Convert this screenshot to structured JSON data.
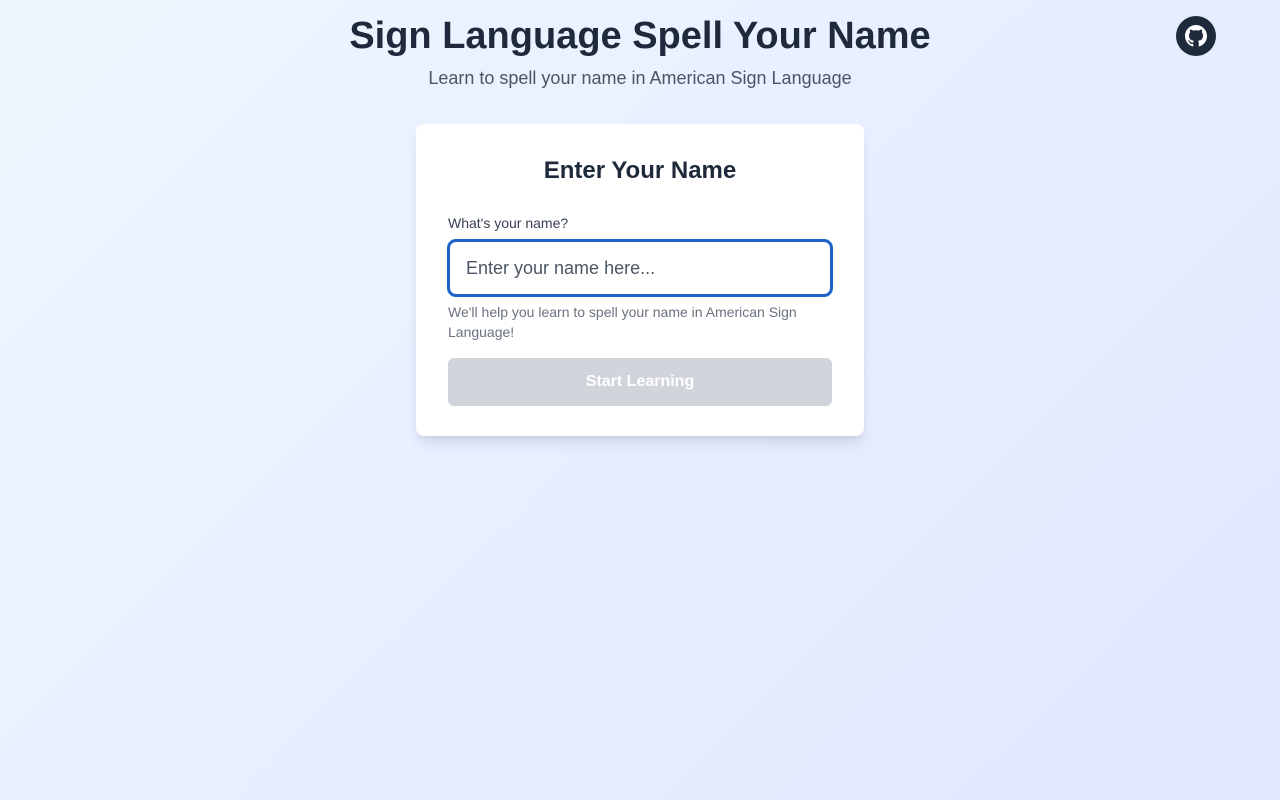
{
  "header": {
    "title": "Sign Language Spell Your Name",
    "subtitle": "Learn to spell your name in American Sign Language"
  },
  "github": {
    "icon": "github-icon",
    "color": "#1e293b"
  },
  "card": {
    "title": "Enter Your Name",
    "label": "What's your name?",
    "input": {
      "value": "",
      "placeholder": "Enter your name here..."
    },
    "helper": "We'll help you learn to spell your name in American Sign Language!",
    "button_label": "Start Learning",
    "button_state": "disabled"
  },
  "colors": {
    "accent": "#1d63c9",
    "button_disabled": "#d1d5db",
    "text_dark": "#1e293b"
  }
}
